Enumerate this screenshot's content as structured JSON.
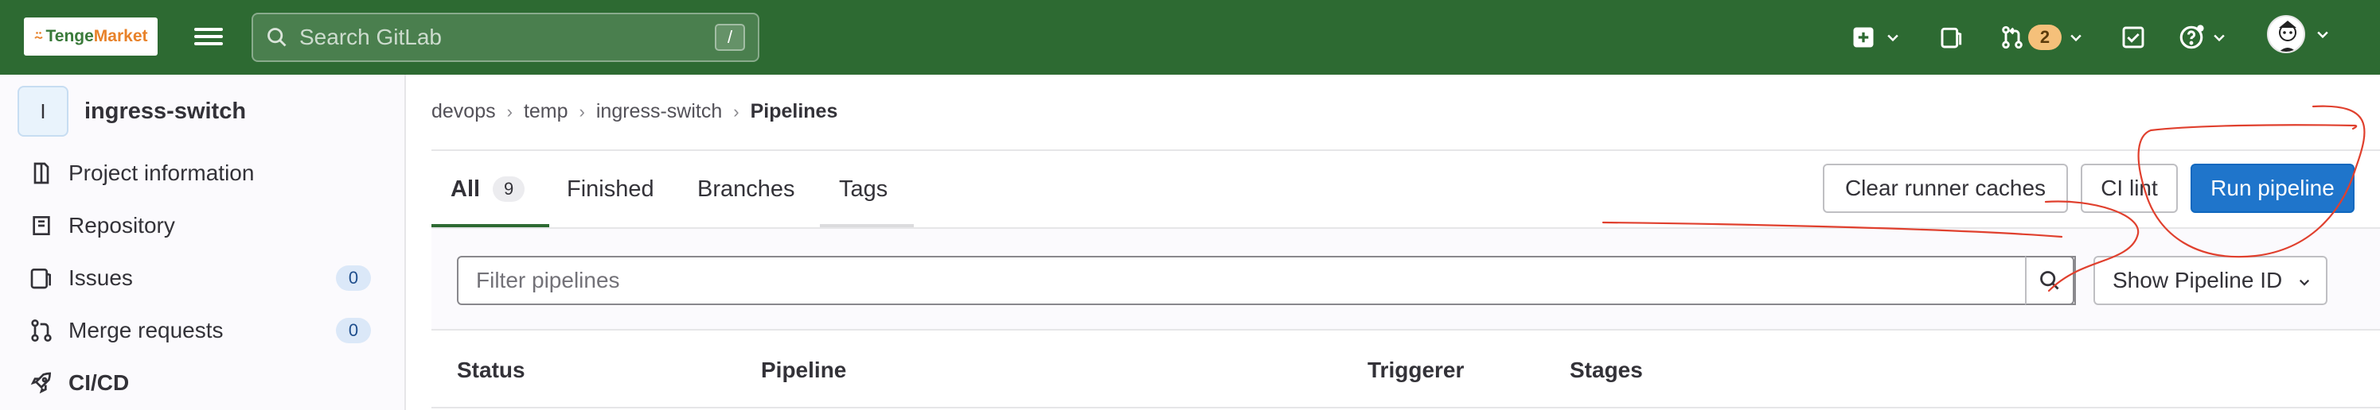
{
  "topbar": {
    "logo_text_1": "Tenge",
    "logo_text_2": "Market",
    "search_placeholder": "Search GitLab",
    "search_shortcut": "/",
    "merge_requests_count": "2",
    "icons": [
      "plus-square-icon",
      "issues-icon",
      "merge-request-icon",
      "todo-icon",
      "help-icon",
      "user-avatar"
    ]
  },
  "sidebar": {
    "project_initial": "I",
    "project_name": "ingress-switch",
    "items": [
      {
        "label": "Project information",
        "icon": "project-info-icon"
      },
      {
        "label": "Repository",
        "icon": "repository-icon"
      },
      {
        "label": "Issues",
        "icon": "issues-icon",
        "count": "0"
      },
      {
        "label": "Merge requests",
        "icon": "merge-request-icon",
        "count": "0"
      },
      {
        "label": "CI/CD",
        "icon": "rocket-icon"
      }
    ]
  },
  "breadcrumb": [
    "devops",
    "temp",
    "ingress-switch",
    "Pipelines"
  ],
  "tabs": [
    {
      "label": "All",
      "count": "9"
    },
    {
      "label": "Finished"
    },
    {
      "label": "Branches"
    },
    {
      "label": "Tags"
    }
  ],
  "actions": {
    "clear_caches": "Clear runner caches",
    "ci_lint": "CI lint",
    "run_pipeline": "Run pipeline"
  },
  "filter": {
    "placeholder": "Filter pipelines",
    "dropdown_value": "Show Pipeline ID"
  },
  "table": {
    "headers": [
      "Status",
      "Pipeline",
      "Triggerer",
      "Stages"
    ]
  },
  "colors": {
    "topbar": "#2d6a32",
    "primary": "#1f75cb",
    "annotation": "#e0402e"
  }
}
